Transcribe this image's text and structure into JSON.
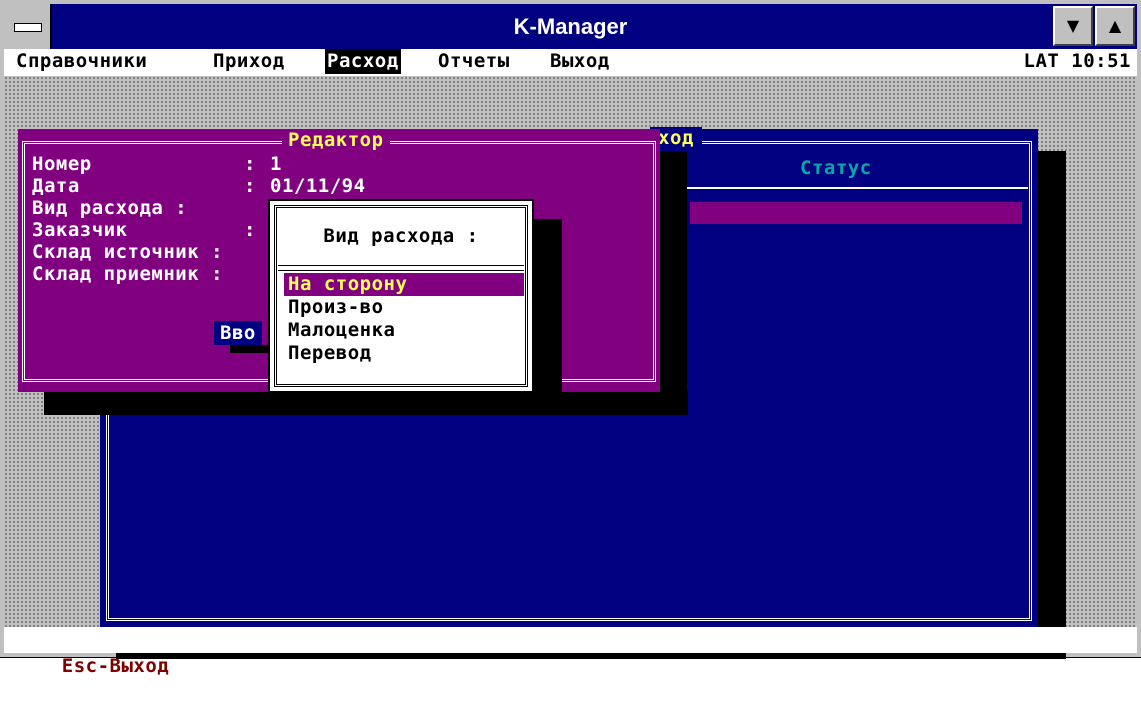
{
  "window": {
    "title": "K-Manager"
  },
  "menubar": {
    "items": [
      "Справочники",
      "Приход",
      "Расход",
      "Отчеты",
      "Выход"
    ],
    "active": "Расход",
    "indicator": "LAT 10:51"
  },
  "list_window": {
    "title": "ход",
    "column_status": "Статус"
  },
  "editor": {
    "title": "Редактор",
    "fields": [
      {
        "label": "Номер",
        "colon": ":",
        "value": "1"
      },
      {
        "label": "Дата",
        "colon": ":",
        "value": "01/11/94"
      },
      {
        "label": "Вид расхода :",
        "colon": "",
        "value": ""
      },
      {
        "label": "Заказчик",
        "colon": ":",
        "value": ""
      },
      {
        "label": "Склад источник :",
        "colon": "",
        "value": ""
      },
      {
        "label": "Склад приемник :",
        "colon": "",
        "value": ""
      }
    ],
    "enter_button": "Вво"
  },
  "popup": {
    "title": "Вид расхода :",
    "options": [
      "На сторону",
      "Произ-во",
      "Малоценка",
      "Перевод"
    ],
    "selected_index": 0
  },
  "statusbar": {
    "text": "Esc-Выход"
  },
  "colors": {
    "titlebar": "#000080",
    "desktop_pattern": "#c0c0c0",
    "editor_bg": "#800080",
    "list_bg": "#000080",
    "highlight_text": "#ffff55",
    "status_text": "#800000"
  }
}
